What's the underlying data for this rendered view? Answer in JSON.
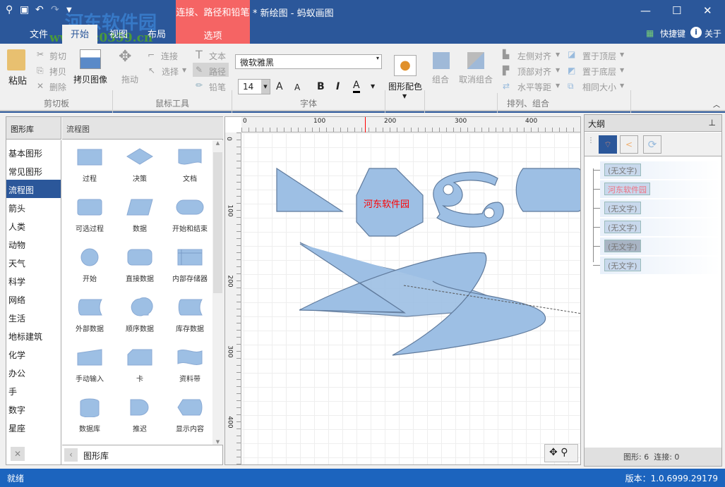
{
  "title": {
    "document": "* 新绘图 - 蚂蚁画图",
    "context_tab_group": "连接、路径和铅笔",
    "context_tab": "选项"
  },
  "tabs": [
    "文件",
    "开始",
    "视图",
    "布局"
  ],
  "help": {
    "shortcuts": "快捷键",
    "about": "关于"
  },
  "watermark": {
    "name": "河东软件园",
    "url": "www.pc0359.cn"
  },
  "ribbon": {
    "clipboard": {
      "label": "剪切板",
      "paste": "粘贴",
      "cut": "剪切",
      "copy": "拷贝",
      "delete": "删除",
      "copy_image": "拷贝图像"
    },
    "mouse": {
      "label": "鼠标工具",
      "drag": "拖动",
      "connect": "连接",
      "select": "选择",
      "text": "文本",
      "path": "路径",
      "pencil": "铅笔"
    },
    "font": {
      "label": "字体",
      "family": "微软雅黑",
      "size": "14",
      "bold": "B",
      "italic": "I",
      "color": "A",
      "grow": "A",
      "shrink": "A"
    },
    "color": {
      "label": "图形配色"
    },
    "arrange": {
      "label": "排列、组合",
      "group": "组合",
      "ungroup": "取消组合",
      "align_left": "左侧对齐",
      "align_top": "顶部对齐",
      "distribute_h": "水平等距",
      "bring_front": "置于顶层",
      "send_back": "置于底层",
      "same_size": "相同大小"
    }
  },
  "library": {
    "header": "图形库",
    "current": "流程图",
    "footer": "图形库",
    "categories": [
      "基本图形",
      "常见图形",
      "流程图",
      "箭头",
      "人类",
      "动物",
      "天气",
      "科学",
      "网络",
      "生活",
      "地标建筑",
      "化学",
      "办公",
      "手",
      "数字",
      "星座"
    ],
    "shapes": [
      "过程",
      "决策",
      "文档",
      "可选过程",
      "数据",
      "开始和结束",
      "开始",
      "直接数据",
      "内部存储器",
      "外部数据",
      "顺序数据",
      "库存数据",
      "手动输入",
      "卡",
      "资料带",
      "数据库",
      "推迟",
      "显示内容"
    ]
  },
  "ruler": {
    "h": [
      "0",
      "100",
      "200",
      "300",
      "400"
    ],
    "v": [
      "0",
      "100",
      "200",
      "300",
      "400"
    ]
  },
  "canvas": {
    "octagon_text": "河东软件园",
    "text_color": "#ff0000",
    "shape_fill": "#9dbfe4"
  },
  "outline": {
    "title": "大纲",
    "items": [
      "(无文字)",
      "河东软件园",
      "(无文字)",
      "(无文字)",
      "(无文字)",
      "(无文字)"
    ],
    "shapes": "图形: 6",
    "connections": "连接: 0"
  },
  "status": {
    "left": "就绪",
    "version": "版本：1.0.6999.29179"
  }
}
